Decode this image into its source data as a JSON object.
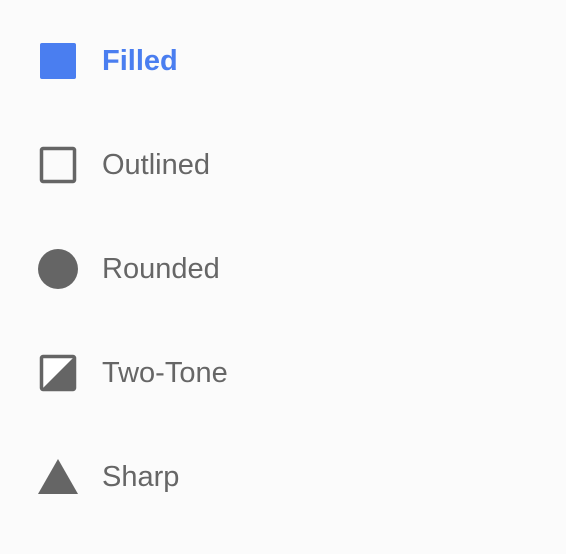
{
  "theme": {
    "accent_color": "#4a7ef0",
    "icon_color": "#656565",
    "text_color": "#666666",
    "background": "#fbfbfb"
  },
  "menu": {
    "selected": "Filled",
    "items": [
      {
        "label": "Filled",
        "icon": "filled-square-icon",
        "selected": true
      },
      {
        "label": "Outlined",
        "icon": "outlined-square-icon",
        "selected": false
      },
      {
        "label": "Rounded",
        "icon": "circle-icon",
        "selected": false
      },
      {
        "label": "Two-Tone",
        "icon": "two-tone-square-icon",
        "selected": false
      },
      {
        "label": "Sharp",
        "icon": "triangle-icon",
        "selected": false
      }
    ]
  }
}
